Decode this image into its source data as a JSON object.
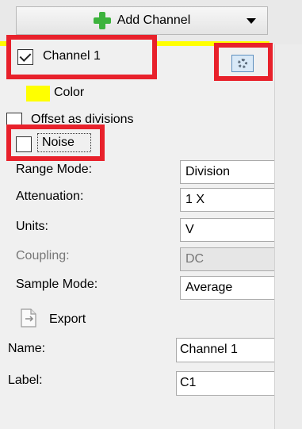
{
  "toolbar": {
    "add_channel_label": "Add Channel"
  },
  "channel": {
    "name_label": "Channel 1",
    "color_label": "Color",
    "color_hex": "#ffff00",
    "offset_label": "Offset as divisions",
    "noise_label": "Noise",
    "checked": true
  },
  "settings": {
    "range_mode_label": "Range Mode:",
    "range_mode_value": "Division",
    "attenuation_label": "Attenuation:",
    "attenuation_value": "1 X",
    "units_label": "Units:",
    "units_value": "V",
    "coupling_label": "Coupling:",
    "coupling_value": "DC",
    "sample_mode_label": "Sample Mode:",
    "sample_mode_value": "Average"
  },
  "export": {
    "label": "Export"
  },
  "fields": {
    "name_label": "Name:",
    "name_value": "Channel 1",
    "label_label": "Label:",
    "label_value": "C1"
  },
  "highlight_color": "#e8212b"
}
